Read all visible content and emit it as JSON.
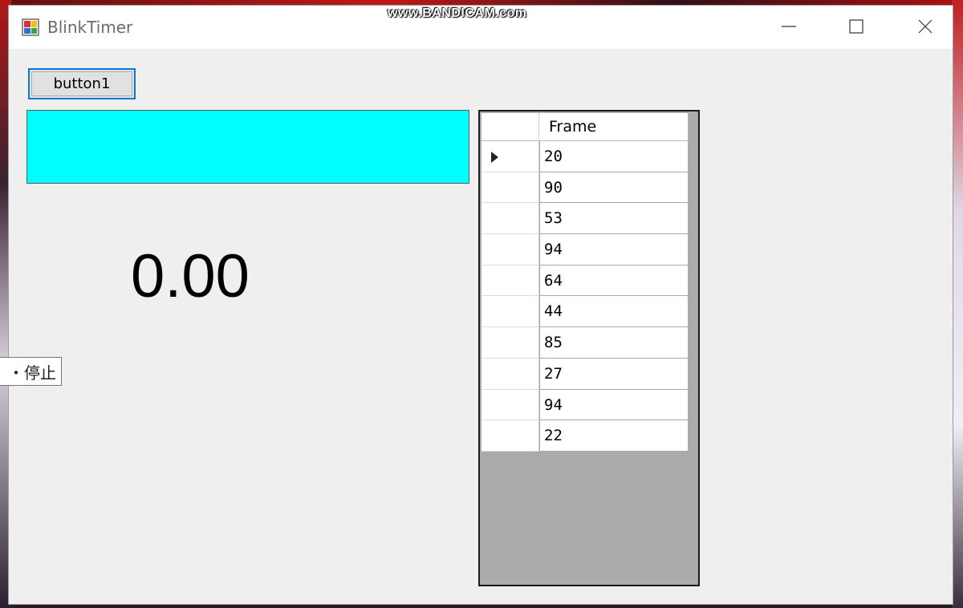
{
  "window": {
    "title": "BlinkTimer",
    "watermark": "www.BANDICAM.com"
  },
  "controls": {
    "button1_label": "button1",
    "timer_value": "0.00",
    "panel_color": "#00ffff",
    "tooltip_text": "・停止"
  },
  "grid": {
    "column_header": "Frame",
    "current_row": 0,
    "rows": [
      "20",
      "90",
      "53",
      "94",
      "64",
      "44",
      "85",
      "27",
      "94",
      "22"
    ]
  }
}
